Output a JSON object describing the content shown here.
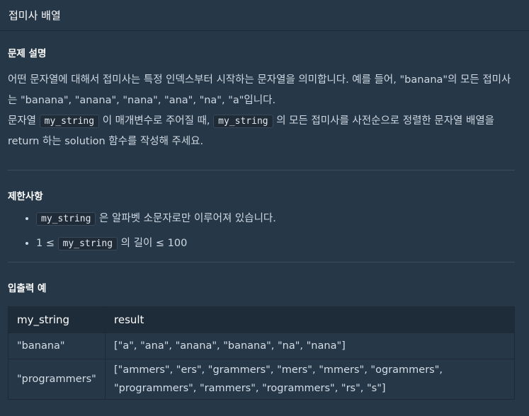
{
  "header": {
    "title": "접미사 배열"
  },
  "description": {
    "heading": "문제 설명",
    "line1": "어떤 문자열에 대해서 접미사는 특정 인덱스부터 시작하는 문자열을 의미합니다. 예를 들어, \"banana\"의 모든 접미사는 \"banana\", \"anana\", \"nana\", \"ana\", \"na\", \"a\"입니다.",
    "line2_part1": "문자열 ",
    "line2_code1": "my_string",
    "line2_part2": " 이 매개변수로 주어질 때, ",
    "line2_code2": "my_string",
    "line2_part3": " 의 모든 접미사를 사전순으로 정렬한 문자열 배열을 return 하는 solution 함수를 작성해 주세요."
  },
  "constraints": {
    "heading": "제한사항",
    "items": [
      {
        "code": "my_string",
        "text_after": " 은 알파벳 소문자로만 이루어져 있습니다."
      },
      {
        "text_before": "1 ≤ ",
        "code": "my_string",
        "text_after": " 의 길이 ≤ 100"
      }
    ]
  },
  "examples": {
    "heading": "입출력 예",
    "columns": [
      "my_string",
      "result"
    ],
    "rows": [
      {
        "my_string": "\"banana\"",
        "result": "[\"a\", \"ana\", \"anana\", \"banana\", \"na\", \"nana\"]"
      },
      {
        "my_string": "\"programmers\"",
        "result": "[\"ammers\", \"ers\", \"grammers\", \"mers\", \"mmers\", \"ogrammers\", \"programmers\", \"rammers\", \"rogrammers\", \"rs\", \"s\"]"
      }
    ]
  }
}
